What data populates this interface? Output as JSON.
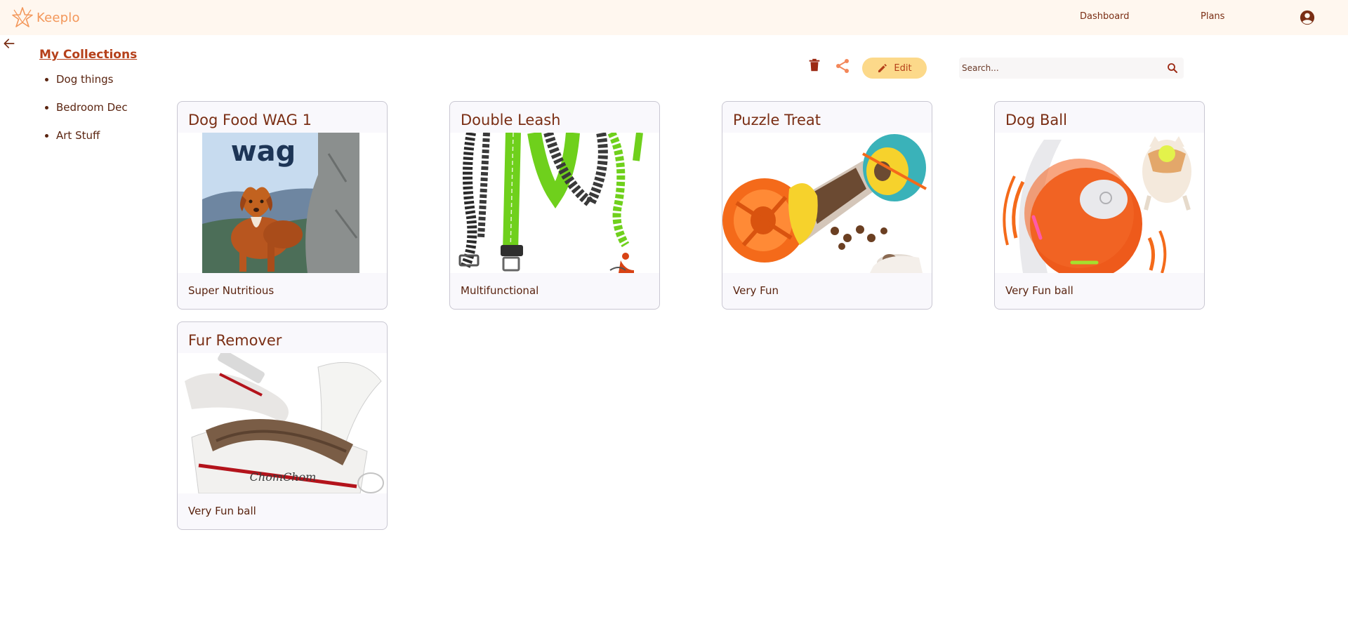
{
  "header": {
    "logo_text": "Keeplo",
    "nav": {
      "dashboard": "Dashboard",
      "plans": "Plans"
    }
  },
  "sidebar": {
    "title": "My Collections",
    "items": [
      {
        "label": "Dog things"
      },
      {
        "label": "Bedroom Dec"
      },
      {
        "label": "Art Stuff"
      }
    ]
  },
  "toolbar": {
    "edit_label": "Edit",
    "search_placeholder": "Search..."
  },
  "items": [
    {
      "title": "Dog Food WAG 1",
      "description": "Super Nutritious",
      "image_icon": "dog-food-image"
    },
    {
      "title": "Double Leash",
      "description": "Multifunctional",
      "image_icon": "leash-image"
    },
    {
      "title": "Puzzle Treat",
      "description": "Very Fun",
      "image_icon": "puzzle-toy-image"
    },
    {
      "title": "Dog Ball",
      "description": "Very Fun ball",
      "image_icon": "dog-ball-image"
    },
    {
      "title": "Fur Remover",
      "description": "Very Fun ball",
      "image_icon": "fur-remover-image"
    }
  ],
  "product_image_text": {
    "wag_logo": "wag",
    "chom_chom_logo": "ChomChom"
  },
  "colors": {
    "brand_orange": "#f3975a",
    "primary_text": "#7a2e14",
    "link": "#b5401a",
    "edit_button_bg": "#fcd98a",
    "header_bg": "#fff7ef",
    "card_bg": "#f9f8fc"
  }
}
